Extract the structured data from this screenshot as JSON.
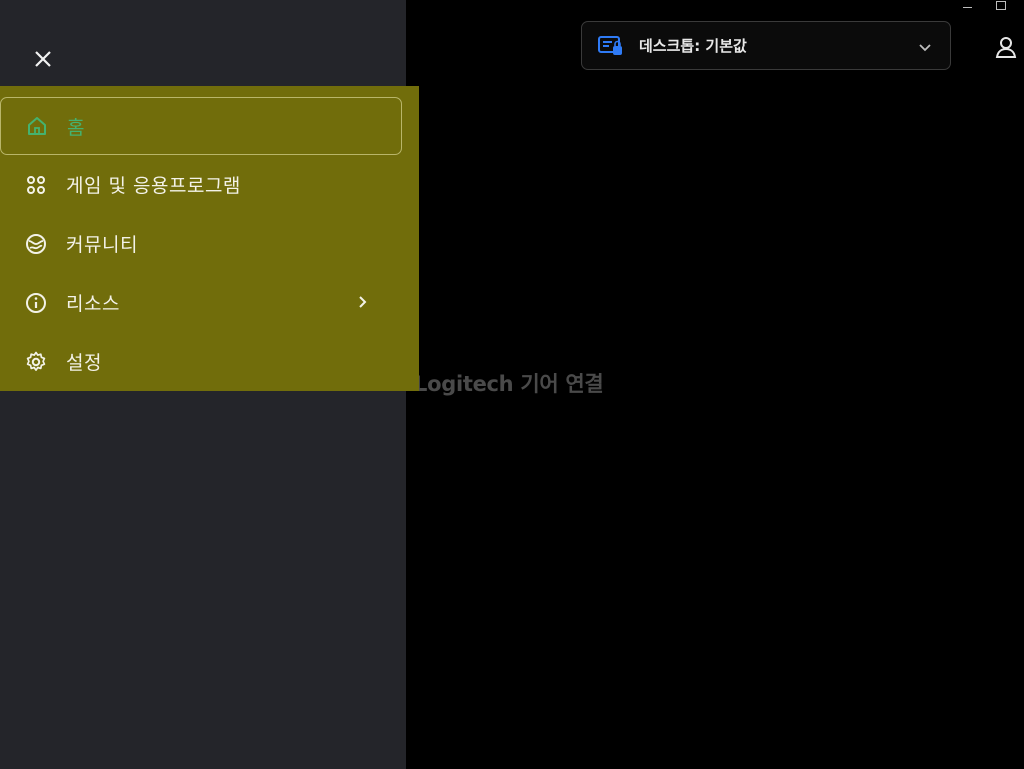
{
  "window": {
    "minimize_icon": "minimize-icon",
    "maximize_icon": "maximize-icon"
  },
  "header": {
    "profile_label": "데스크톱: 기본값",
    "profile_icon": "desktop-profile-icon",
    "dropdown_icon": "chevron-down-icon",
    "account_icon": "user-icon"
  },
  "main": {
    "connect_text": "Logitech 기어 연결"
  },
  "sidebar": {
    "close_icon": "close-icon",
    "items": [
      {
        "label": "홈",
        "icon": "home-icon",
        "active": true
      },
      {
        "label": "게임 및 응용프로그램",
        "icon": "apps-grid-icon",
        "active": false
      },
      {
        "label": "커뮤니티",
        "icon": "community-icon",
        "active": false
      },
      {
        "label": "리소스",
        "icon": "info-icon",
        "active": false,
        "has_submenu": true
      },
      {
        "label": "설정",
        "icon": "settings-gear-icon",
        "active": false
      }
    ]
  },
  "colors": {
    "accent_green": "#45b26f",
    "highlight": "#716d0b",
    "sidebar_bg": "#24252a",
    "profile_icon_blue": "#2f7bf6"
  }
}
